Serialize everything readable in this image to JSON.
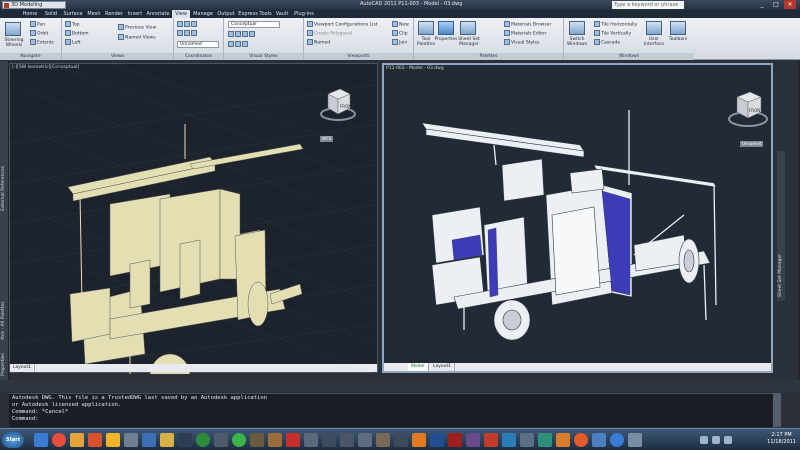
{
  "titlebar": {
    "workspace": "3D Modeling",
    "title": "AutoCAD 2011   P11-003 - Model - 03.dwg",
    "search_placeholder": "Type a keyword or phrase"
  },
  "tabs": [
    "Home",
    "Solid",
    "Surface",
    "Mesh",
    "Render",
    "Insert",
    "Annotate",
    "View",
    "Manage",
    "Output",
    "Express Tools",
    "Vault",
    "Plug-ins"
  ],
  "active_tab": "View",
  "ribbon": {
    "navigate": {
      "title": "Navigate",
      "steering": "Steering Wheels",
      "items": [
        "Pan",
        "Orbit",
        "Extents"
      ]
    },
    "views": {
      "title": "Views",
      "items": [
        "Top",
        "Bottom",
        "Left"
      ],
      "items2": [
        "Previous View",
        "Named Views"
      ]
    },
    "coordinates": {
      "title": "Coordinates",
      "ucs": "Unnamed"
    },
    "visual_styles": {
      "title": "Visual Styles",
      "style": "Conceptual"
    },
    "viewports": {
      "title": "Viewports",
      "items": [
        "Viewport Configurations List",
        "Create Polygonal",
        "Named"
      ],
      "items2": [
        "New",
        "Clip",
        "Join"
      ]
    },
    "palettes": {
      "title": "Palettes",
      "big": [
        "Tool Palettes",
        "Properties",
        "Sheet Set Manager"
      ],
      "items": [
        "Materials Browser",
        "Materials Editor",
        "Visual Styles"
      ]
    },
    "windows": {
      "title": "Windows",
      "switch": "Switch Windows",
      "items": [
        "Tile Horizontally",
        "Tile Vertically",
        "Cascade"
      ],
      "ui": "User Interface",
      "toolbars": "Toolbars"
    }
  },
  "palette_strips": {
    "left": [
      "External References",
      "Tool Palettes - All Palettes",
      "Properties"
    ],
    "right": "Sheet Set Manager"
  },
  "viewports": {
    "left": {
      "label": "[-][SW Isometric][Conceptual]",
      "wcs": "WCS",
      "tab": "Layout1"
    },
    "right": {
      "label": "P11-003 - Model - 03.dwg",
      "wcs": "Unnamed",
      "tabs": [
        "Model",
        "Layout1"
      ]
    },
    "cube_face": "FRONT"
  },
  "command_lines": [
    "Autodesk DWG.  This file is a TrustedDWG last saved by an Autodesk application",
    "or Autodesk licensed application.",
    "Command: *Cancel*",
    "Command:"
  ],
  "taskbar": {
    "start": "Start",
    "time": "2:17 PM",
    "date": "11/18/2011"
  }
}
